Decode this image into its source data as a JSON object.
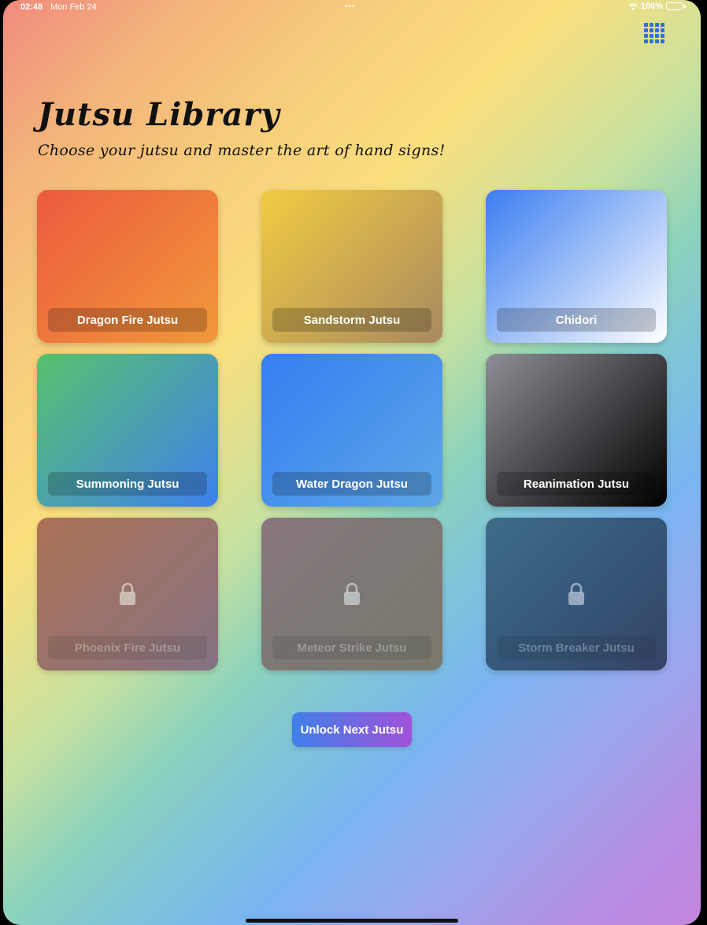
{
  "status_bar": {
    "time": "02:48",
    "date": "Mon Feb 24",
    "dots": "•••",
    "battery": "100%"
  },
  "icons": {
    "menu": "grid-icon",
    "lock": "lock-icon",
    "wifi": "wifi-icon",
    "battery": "battery-icon"
  },
  "header": {
    "title": "Jutsu Library",
    "subtitle": "Choose your jutsu and master the art of hand signs!"
  },
  "jutsus": [
    {
      "name": "Dragon Fire Jutsu",
      "locked": false,
      "gradient": [
        "#ec5a3e",
        "#f1993a"
      ]
    },
    {
      "name": "Sandstorm Jutsu",
      "locked": false,
      "gradient": [
        "#f2cb40",
        "#a88a60"
      ]
    },
    {
      "name": "Chidori",
      "locked": false,
      "gradient": [
        "#3b7ef0",
        "#ffffff"
      ]
    },
    {
      "name": "Summoning Jutsu",
      "locked": false,
      "gradient": [
        "#58c26a",
        "#3f7ff0"
      ]
    },
    {
      "name": "Water Dragon Jutsu",
      "locked": false,
      "gradient": [
        "#347ef2",
        "#5ea6e6"
      ]
    },
    {
      "name": "Reanimation Jutsu",
      "locked": false,
      "gradient": [
        "#8e8e96",
        "#000000"
      ]
    },
    {
      "name": "Phoenix Fire Jutsu",
      "locked": true,
      "gradient": [
        "#9a5a4e",
        "#7e5c78"
      ]
    },
    {
      "name": "Meteor Strike Jutsu",
      "locked": true,
      "gradient": [
        "#7c6078",
        "#7a6a50"
      ]
    },
    {
      "name": "Storm Breaker Jutsu",
      "locked": true,
      "gradient": [
        "#305a78",
        "#1e2e48"
      ]
    }
  ],
  "unlock_button": {
    "label": "Unlock Next Jutsu"
  }
}
